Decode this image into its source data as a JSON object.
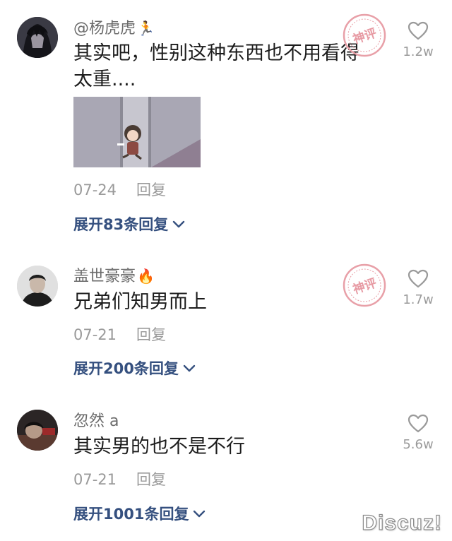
{
  "comments": [
    {
      "username": "@杨虎虎",
      "username_emoji": "🏃",
      "text": "其实吧，性别这种东西也不用看得太重....",
      "date": "07-24",
      "reply_label": "回复",
      "expand_label": "展开83条回复",
      "like_count": "1.2w",
      "stamp_text": "神评",
      "has_gif": true
    },
    {
      "username": "盖世豪豪",
      "username_emoji": "🔥",
      "text": "兄弟们知男而上",
      "date": "07-21",
      "reply_label": "回复",
      "expand_label": "展开200条回复",
      "like_count": "1.7w",
      "stamp_text": "神评"
    },
    {
      "username": "忽然 a",
      "text": "其实男的也不是不行",
      "date": "07-21",
      "reply_label": "回复",
      "expand_label": "展开1001条回复",
      "like_count": "5.6w"
    }
  ],
  "watermark": "Discuz!",
  "colors": {
    "link": "#35507f",
    "muted": "#9a9a9a",
    "stamp": "#e8a0a8"
  },
  "icons": {
    "like": "heart-outline-icon",
    "expand": "chevron-down-icon"
  }
}
